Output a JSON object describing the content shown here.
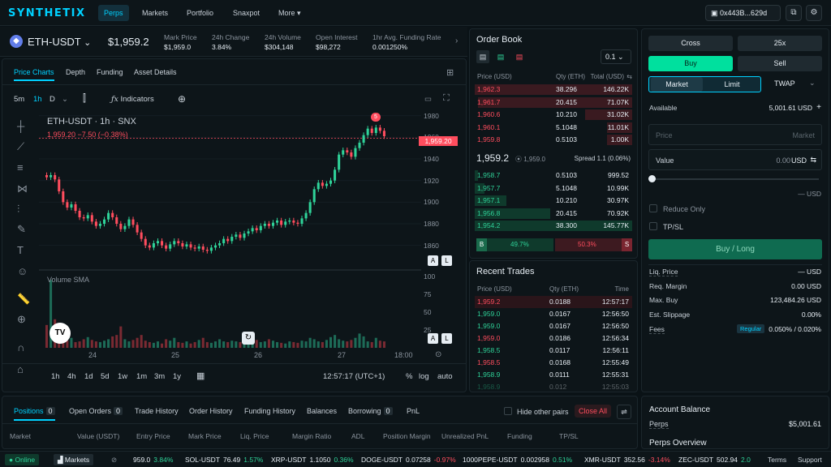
{
  "nav": {
    "logo": "SYNTHETIX",
    "items": [
      "Perps",
      "Markets",
      "Portfolio",
      "Snaxpot",
      "More"
    ],
    "wallet": "0x443B...629d"
  },
  "market": {
    "pair": "ETH-USDT",
    "price": "$1,959.2",
    "stats": [
      {
        "label": "Mark Price",
        "value": "$1,959.0",
        "tone": ""
      },
      {
        "label": "24h Change",
        "value": "3.84%",
        "tone": "green"
      },
      {
        "label": "24h Volume",
        "value": "$304,148",
        "tone": ""
      },
      {
        "label": "Open Interest",
        "value": "$98,272",
        "tone": ""
      },
      {
        "label": "1hr Avg. Funding Rate",
        "value": "0.001250%",
        "tone": "green"
      }
    ]
  },
  "chart": {
    "tabs": [
      "Price Charts",
      "Depth",
      "Funding",
      "Asset Details"
    ],
    "toolbar": {
      "tf5m": "5m",
      "tf1h": "1h",
      "tfD": "D",
      "indicators": "Indicators"
    },
    "legend_title": "ETH-USDT  ·  1h  ·  SNX",
    "legend_ohlc": "1,959.20  −7.50 (−0.38%)",
    "price_tag": "1,959.20",
    "volume_label": "Volume SMA",
    "marker_label": "5",
    "range_buttons": [
      "1h",
      "4h",
      "1d",
      "5d",
      "1w",
      "1m",
      "3m",
      "1y"
    ],
    "time": "12:57:17 (UTC+1)",
    "scale_opts": [
      "%",
      "log",
      "auto"
    ],
    "a_label": "A",
    "l_label": "L"
  },
  "chart_data": {
    "type": "bar",
    "title": "ETH-USDT 1h SNX",
    "x_ticks": [
      "24",
      "25",
      "26",
      "27",
      "18:00"
    ],
    "y_ticks": [
      1980,
      1960,
      1940,
      1920,
      1900,
      1880,
      1860
    ],
    "ylim": [
      1850,
      1985
    ],
    "volume_ticks": [
      100,
      75,
      50,
      25
    ],
    "last_price": 1959.2,
    "candles": [
      1923,
      1925,
      1921,
      1910,
      1900,
      1895,
      1898,
      1892,
      1886,
      1885,
      1888,
      1882,
      1878,
      1880,
      1884,
      1890,
      1886,
      1880,
      1875,
      1878,
      1884,
      1879,
      1872,
      1866,
      1860,
      1858,
      1862,
      1864,
      1860,
      1857,
      1861,
      1864,
      1862,
      1859,
      1861,
      1858,
      1857,
      1859,
      1856,
      1855,
      1858,
      1860,
      1862,
      1866,
      1864,
      1868,
      1870,
      1867,
      1871,
      1873,
      1876,
      1874,
      1878,
      1880,
      1878,
      1881,
      1883,
      1879,
      1882,
      1883,
      1881,
      1880,
      1885,
      1890,
      1900,
      1912,
      1918,
      1915,
      1917,
      1920,
      1930,
      1944,
      1948,
      1946,
      1942,
      1950,
      1955,
      1962,
      1968,
      1964,
      1969,
      1966,
      1961
    ],
    "volumes": [
      32,
      95,
      40,
      22,
      18,
      10,
      14,
      8,
      9,
      12,
      15,
      11,
      9,
      8,
      10,
      12,
      16,
      18,
      30,
      12,
      9,
      11,
      14,
      18,
      10,
      8,
      7,
      9,
      6,
      12,
      10,
      14,
      8,
      7,
      9,
      6,
      8,
      11,
      14,
      8,
      7,
      9,
      12,
      9,
      8,
      10,
      9,
      8,
      7,
      9,
      10,
      11,
      8,
      9,
      12,
      10,
      8,
      7,
      6,
      9,
      8,
      7,
      10,
      9,
      14,
      12,
      9,
      8,
      11,
      15,
      18,
      12,
      10,
      9,
      11,
      14,
      20,
      16,
      9,
      8,
      14,
      10,
      9
    ]
  },
  "orderbook": {
    "title": "Order Book",
    "size": "0.1",
    "headers": [
      "Price (USD)",
      "Qty (ETH)",
      "Total (USD)"
    ],
    "asks": [
      {
        "p": "1,962.3",
        "q": "38.296",
        "t": "146.22K",
        "w": 100
      },
      {
        "p": "1,961.7",
        "q": "20.415",
        "t": "71.07K",
        "w": 98
      },
      {
        "p": "1,960.6",
        "q": "10.210",
        "t": "31.02K",
        "w": 30
      },
      {
        "p": "1,960.1",
        "q": "5.1048",
        "t": "11.01K",
        "w": 16
      },
      {
        "p": "1,959.8",
        "q": "0.5103",
        "t": "1.00K",
        "w": 16
      }
    ],
    "mid": "1,959.2",
    "mid_mark": "1,959.0",
    "spread": "Spread 1.1 (0.06%)",
    "bids": [
      {
        "p": "1,958.7",
        "q": "0.5103",
        "t": "999.52",
        "w": 2
      },
      {
        "p": "1,957.7",
        "q": "5.1048",
        "t": "10.99K",
        "w": 6
      },
      {
        "p": "1,957.1",
        "q": "10.210",
        "t": "30.97K",
        "w": 20
      },
      {
        "p": "1,956.8",
        "q": "20.415",
        "t": "70.92K",
        "w": 48
      },
      {
        "p": "1,954.2",
        "q": "38.300",
        "t": "145.77K",
        "w": 100
      }
    ],
    "buy_pct": "49.7%",
    "sell_pct": "50.3%",
    "b": "B",
    "s": "S"
  },
  "trades": {
    "title": "Recent Trades",
    "headers": [
      "Price (USD)",
      "Qty (ETH)",
      "Time"
    ],
    "rows": [
      {
        "p": "1,959.2",
        "q": "0.0188",
        "t": "12:57:17",
        "side": "red"
      },
      {
        "p": "1,959.0",
        "q": "0.0167",
        "t": "12:56:50",
        "side": "green"
      },
      {
        "p": "1,959.0",
        "q": "0.0167",
        "t": "12:56:50",
        "side": "green"
      },
      {
        "p": "1,959.0",
        "q": "0.0186",
        "t": "12:56:34",
        "side": "red"
      },
      {
        "p": "1,958.5",
        "q": "0.0117",
        "t": "12:56:11",
        "side": "green"
      },
      {
        "p": "1,958.5",
        "q": "0.0168",
        "t": "12:55:49",
        "side": "red"
      },
      {
        "p": "1,958.9",
        "q": "0.0111",
        "t": "12:55:31",
        "side": "green"
      },
      {
        "p": "1,958.9",
        "q": "0.012",
        "t": "12:55:03",
        "side": "green"
      }
    ]
  },
  "trade": {
    "margin": "Cross",
    "leverage": "25x",
    "buy": "Buy",
    "sell": "Sell",
    "market": "Market",
    "limit": "Limit",
    "twap": "TWAP",
    "available_label": "Available",
    "available": "5,001.61 USD",
    "price_ph": "Price",
    "price_mode": "Market",
    "value_label": "Value",
    "value": "0.00",
    "value_unit": "USD",
    "slider_unit": "— USD",
    "reduce_only": "Reduce Only",
    "tpsl": "TP/SL",
    "submit": "Buy / Long",
    "details": [
      {
        "label": "Liq. Price",
        "value": "— USD"
      },
      {
        "label": "Req. Margin",
        "value": "0.00 USD"
      },
      {
        "label": "Max. Buy",
        "value": "123,484.26 USD"
      },
      {
        "label": "Est. Slippage",
        "value": "0.00%"
      }
    ],
    "fees_label": "Fees",
    "fees_tier": "Regular",
    "fees_value": "0.050% / 0.020%"
  },
  "positions": {
    "tabs": [
      {
        "label": "Positions",
        "count": "0"
      },
      {
        "label": "Open Orders",
        "count": "0"
      },
      {
        "label": "Trade History",
        "count": ""
      },
      {
        "label": "Order History",
        "count": ""
      },
      {
        "label": "Funding History",
        "count": ""
      },
      {
        "label": "Balances",
        "count": ""
      },
      {
        "label": "Borrowing",
        "count": "0"
      },
      {
        "label": "PnL",
        "count": ""
      }
    ],
    "hide_other": "Hide other pairs",
    "close_all": "Close All",
    "columns": [
      "Market",
      "Value (USDT)",
      "Entry Price",
      "Mark Price",
      "Liq. Price",
      "Margin Ratio",
      "ADL",
      "Position Margin",
      "Unrealized PnL",
      "Funding",
      "TP/SL"
    ]
  },
  "balance": {
    "title": "Account Balance",
    "perps_label": "Perps",
    "perps_value": "$5,001.61",
    "overview": "Perps Overview"
  },
  "ticker": {
    "online": "Online",
    "markets": "Markets",
    "items": [
      {
        "sym": "",
        "price": "959.0",
        "chg": "3.84%",
        "tone": "green"
      },
      {
        "sym": "SOL-USDT",
        "price": "76.49",
        "chg": "1.57%",
        "tone": "green"
      },
      {
        "sym": "XRP-USDT",
        "price": "1.1050",
        "chg": "0.36%",
        "tone": "green"
      },
      {
        "sym": "DOGE-USDT",
        "price": "0.07258",
        "chg": "-0.97%",
        "tone": "red"
      },
      {
        "sym": "1000PEPE-USDT",
        "price": "0.002958",
        "chg": "0.51%",
        "tone": "green"
      },
      {
        "sym": "XMR-USDT",
        "price": "352.56",
        "chg": "-3.14%",
        "tone": "red"
      },
      {
        "sym": "ZEC-USDT",
        "price": "502.94",
        "chg": "2.0",
        "tone": "green"
      }
    ],
    "terms": "Terms",
    "support": "Support"
  }
}
